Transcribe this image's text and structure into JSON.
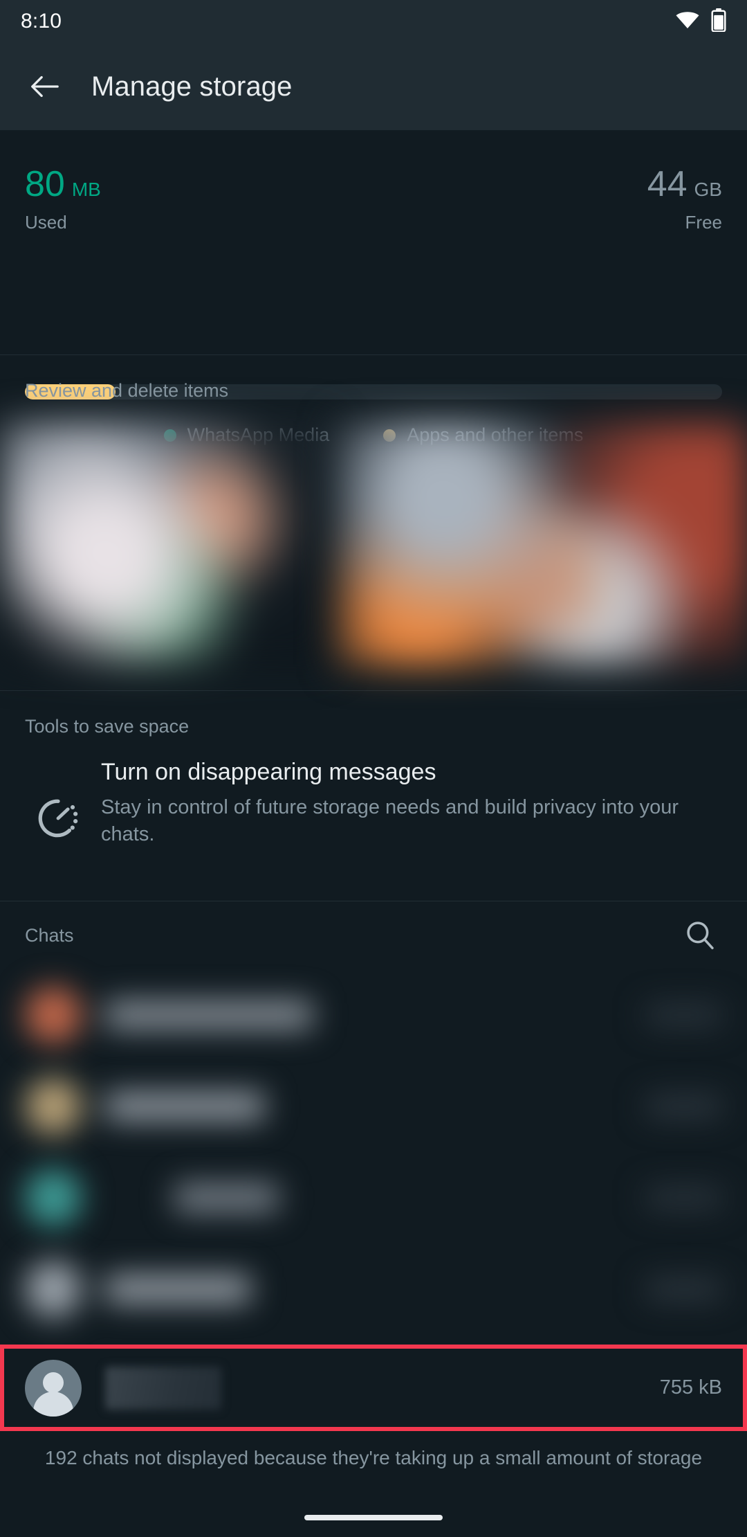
{
  "status_bar": {
    "time": "8:10",
    "wifi_icon": "wifi-icon",
    "battery_icon": "battery-icon"
  },
  "app_bar": {
    "back_icon": "arrow-back-icon",
    "title": "Manage storage"
  },
  "storage_summary": {
    "used": {
      "value": "80",
      "unit": "MB",
      "label": "Used",
      "color": "#00A884"
    },
    "free": {
      "value": "44",
      "unit": "GB",
      "label": "Free",
      "color": "#8696A0"
    },
    "bar": {
      "fill_percent": 13,
      "fill_color": "#FFD279",
      "track_color": "#202C33"
    },
    "legend": [
      {
        "label": "WhatsApp Media",
        "color": "#00A884"
      },
      {
        "label": "Apps and other items",
        "color": "#FFD279"
      }
    ]
  },
  "review_section": {
    "title": "Review and delete items",
    "thumbnails": [
      {
        "name": "media-thumbnail-1"
      },
      {
        "name": "media-thumbnail-2"
      }
    ]
  },
  "tools_section": {
    "title": "Tools to save space",
    "item": {
      "icon": "disappearing-messages-icon",
      "title": "Turn on disappearing messages",
      "subtitle": "Stay in control of future storage needs and build privacy into your chats."
    }
  },
  "chats_section": {
    "title": "Chats",
    "search_icon": "search-icon",
    "rows": [
      {
        "avatar_color": "#C2674A",
        "name_redacted": true,
        "size_redacted": true
      },
      {
        "avatar_color": "#B9A277",
        "name_redacted": true,
        "size_redacted": true
      },
      {
        "avatar_color": "#3E9C96",
        "name_redacted": true,
        "size_redacted": true
      },
      {
        "avatar_color": "#9BA3AB",
        "name_redacted": true,
        "size_redacted": true
      }
    ],
    "highlighted_row": {
      "avatar_icon": "default-person-avatar-icon",
      "name_redacted": true,
      "size": "755 kB",
      "highlight_color": "#F4384F"
    }
  },
  "footer_note": "192 chats not displayed because they're taking up a small amount of storage",
  "theme": {
    "background": "#111B21",
    "surface": "#202C33",
    "accent": "#00A884",
    "text_primary": "#E9EDEF",
    "text_secondary": "#8696A0"
  }
}
